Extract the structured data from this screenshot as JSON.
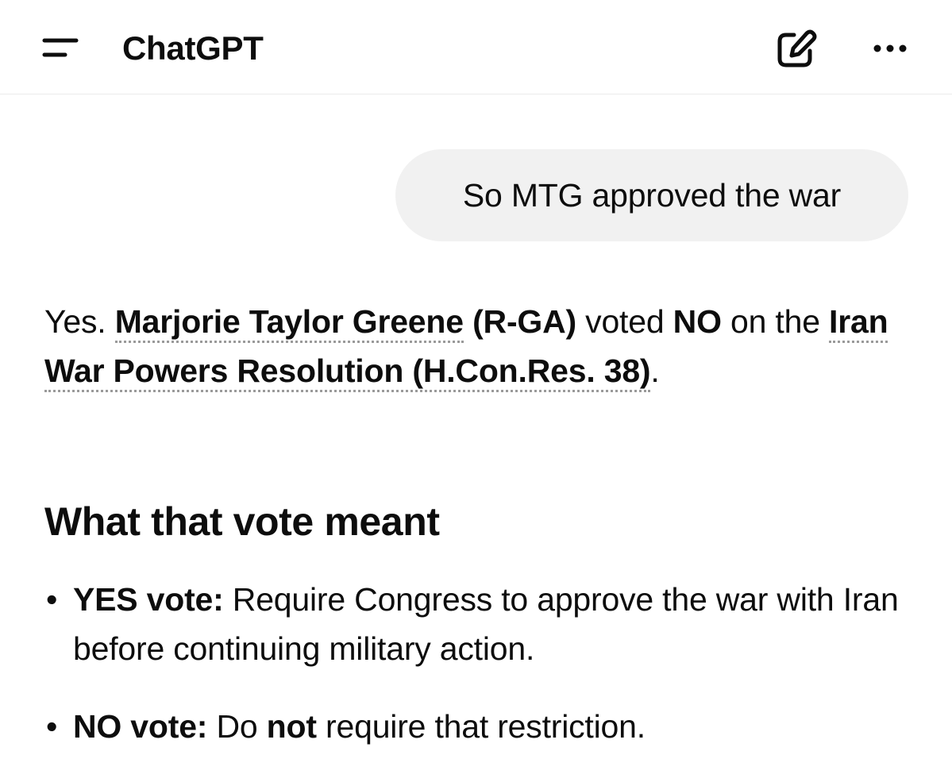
{
  "header": {
    "title": "ChatGPT",
    "menu_icon": "sidebar-menu-icon",
    "edit_icon": "new-chat-edit-icon",
    "more_icon": "more-options-icon"
  },
  "user_message": {
    "text": "So MTG approved the war"
  },
  "answer": {
    "p1_yes": "Yes.",
    "p1_name_link": "Marjorie Taylor Greene",
    "p1_party": "(R-GA)",
    "p1_voted": "voted",
    "p1_no": "NO",
    "p1_on": "on",
    "p1_the": "the",
    "p1_resolution_link": "Iran War Powers Resolution (H.Con.Res. 38)",
    "p1_period": "."
  },
  "section": {
    "heading": "What that vote meant",
    "bullets": [
      {
        "bold": "YES vote:",
        "text": "Require Congress to approve the war with Iran before continuing military action."
      },
      {
        "bold": "NO vote:",
        "text_before": "Do",
        "emphasis": "not",
        "text_after": "require that restriction."
      }
    ]
  }
}
